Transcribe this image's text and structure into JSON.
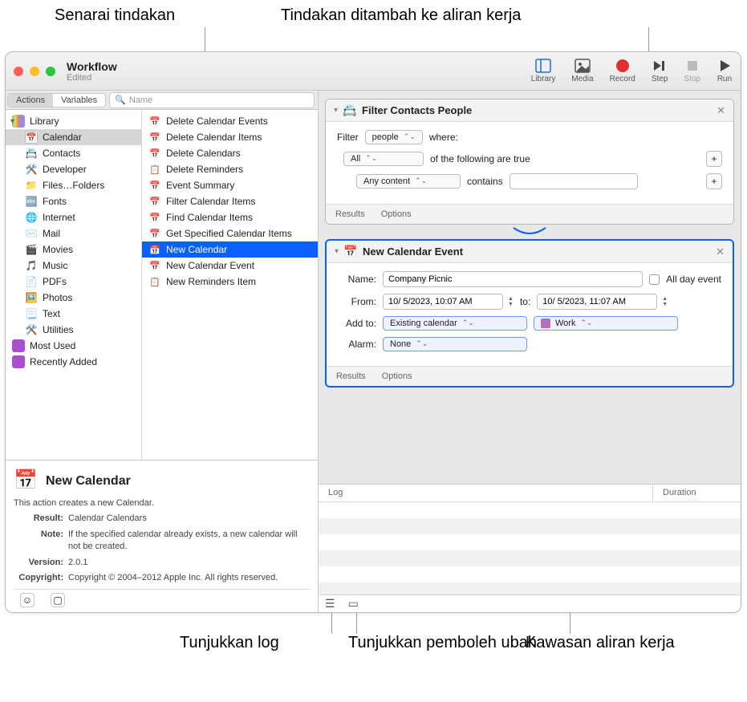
{
  "callouts": {
    "list_actions": "Senarai tindakan",
    "added_actions": "Tindakan ditambah ke aliran kerja",
    "show_log": "Tunjukkan log",
    "show_vars": "Tunjukkan pemboleh ubah",
    "workflow_area": "Kawasan aliran kerja"
  },
  "window": {
    "title": "Workflow",
    "subtitle": "Edited"
  },
  "toolbar": {
    "library": "Library",
    "media": "Media",
    "record": "Record",
    "step": "Step",
    "stop": "Stop",
    "run": "Run"
  },
  "tabs": {
    "actions": "Actions",
    "variables": "Variables"
  },
  "search": {
    "placeholder": "Name"
  },
  "library_label": "Library",
  "categories": [
    {
      "label": "Calendar",
      "icon": "ic-cal",
      "selected": true
    },
    {
      "label": "Contacts",
      "icon": "ic-con"
    },
    {
      "label": "Developer",
      "icon": "ic-dev"
    },
    {
      "label": "Files…Folders",
      "icon": "ic-fil"
    },
    {
      "label": "Fonts",
      "icon": "ic-fon"
    },
    {
      "label": "Internet",
      "icon": "ic-int"
    },
    {
      "label": "Mail",
      "icon": "ic-mai"
    },
    {
      "label": "Movies",
      "icon": "ic-mov"
    },
    {
      "label": "Music",
      "icon": "ic-mus"
    },
    {
      "label": "PDFs",
      "icon": "ic-pdf"
    },
    {
      "label": "Photos",
      "icon": "ic-pho"
    },
    {
      "label": "Text",
      "icon": "ic-txt"
    },
    {
      "label": "Utilities",
      "icon": "ic-uti"
    }
  ],
  "special_cats": [
    {
      "label": "Most Used",
      "icon": "ic-mos"
    },
    {
      "label": "Recently Added",
      "icon": "ic-rec"
    }
  ],
  "actions_list": [
    {
      "label": "Delete Calendar Events",
      "icon": "📅"
    },
    {
      "label": "Delete Calendar Items",
      "icon": "📅"
    },
    {
      "label": "Delete Calendars",
      "icon": "📅"
    },
    {
      "label": "Delete Reminders",
      "icon": "📋"
    },
    {
      "label": "Event Summary",
      "icon": "📅"
    },
    {
      "label": "Filter Calendar Items",
      "icon": "📅"
    },
    {
      "label": "Find Calendar Items",
      "icon": "📅"
    },
    {
      "label": "Get Specified Calendar Items",
      "icon": "📅"
    },
    {
      "label": "New Calendar",
      "icon": "📅",
      "selected": true
    },
    {
      "label": "New Calendar Event",
      "icon": "📅"
    },
    {
      "label": "New Reminders Item",
      "icon": "📋"
    }
  ],
  "desc": {
    "title": "New Calendar",
    "summary": "This action creates a new Calendar.",
    "result_label": "Result:",
    "result": "Calendar Calendars",
    "note_label": "Note:",
    "note": "If the specified calendar already exists, a new calendar will not be created.",
    "version_label": "Version:",
    "version": "2.0.1",
    "copyright_label": "Copyright:",
    "copyright": "Copyright © 2004–2012 Apple Inc.  All rights reserved."
  },
  "action1": {
    "title": "Filter Contacts People",
    "filter_label": "Filter",
    "filter_type": "people",
    "where": "where:",
    "all": "All",
    "following": "of the following are true",
    "any_content": "Any content",
    "contains": "contains",
    "results": "Results",
    "options": "Options"
  },
  "action2": {
    "title": "New Calendar Event",
    "name_label": "Name:",
    "name_value": "Company Picnic",
    "allday": "All day event",
    "from_label": "From:",
    "from_value": "10/ 5/2023, 10:07 AM",
    "to_label": "to:",
    "to_value": "10/ 5/2023, 11:07 AM",
    "addto_label": "Add to:",
    "addto_value": "Existing calendar",
    "calendar": "Work",
    "alarm_label": "Alarm:",
    "alarm_value": "None",
    "results": "Results",
    "options": "Options"
  },
  "log": {
    "col1": "Log",
    "col2": "Duration"
  }
}
